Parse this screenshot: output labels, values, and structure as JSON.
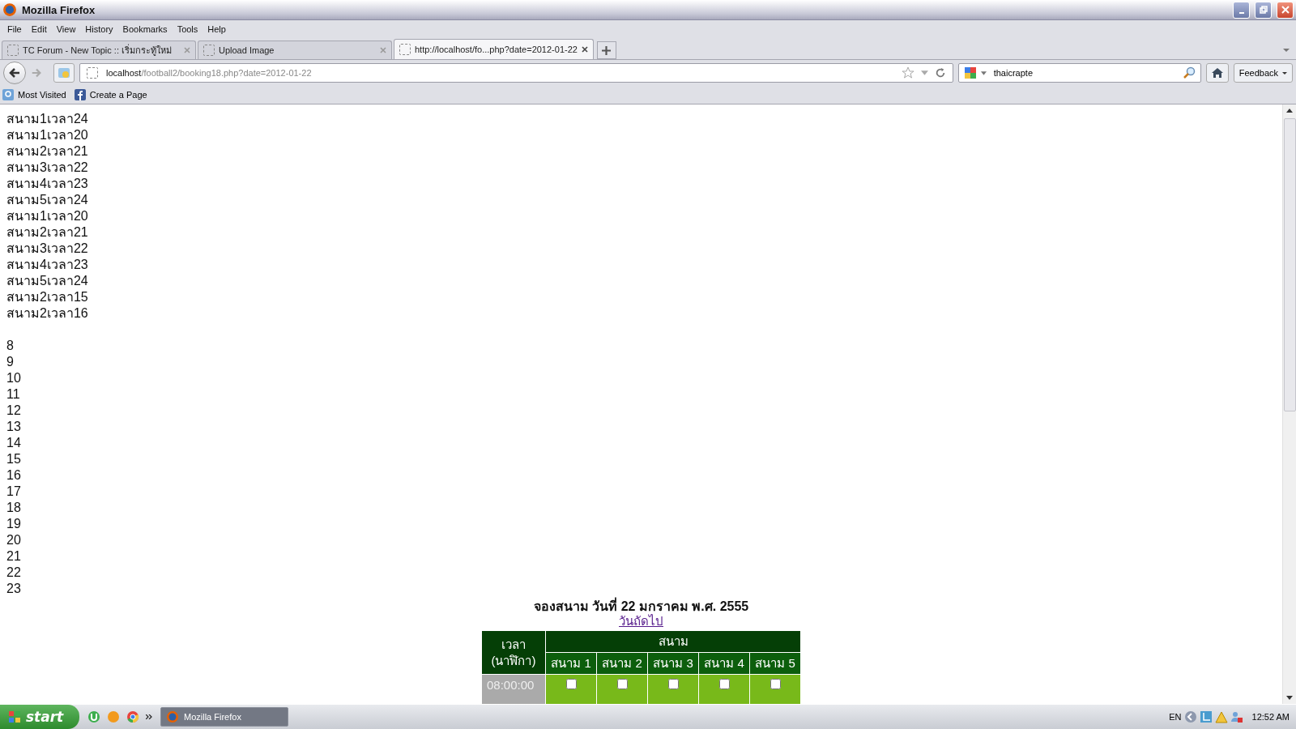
{
  "window": {
    "title": "Mozilla Firefox"
  },
  "menu": [
    "File",
    "Edit",
    "View",
    "History",
    "Bookmarks",
    "Tools",
    "Help"
  ],
  "tabs": [
    {
      "label": "TC Forum - New Topic :: เริ่มกระทู้ใหม่",
      "selected": false
    },
    {
      "label": "Upload Image",
      "selected": false
    },
    {
      "label": "http://localhost/fo...php?date=2012-01-22",
      "selected": true
    }
  ],
  "address": {
    "host": "localhost",
    "path": "/football2/booking18.php?date=2012-01-22"
  },
  "search": {
    "value": "thaicrapte"
  },
  "feedback": "Feedback",
  "bookmarks": [
    "Most Visited",
    "Create a Page"
  ],
  "log_lines": [
    "สนาม1เวลา24",
    "สนาม1เวลา20",
    "สนาม2เวลา21",
    "สนาม3เวลา22",
    "สนาม4เวลา23",
    "สนาม5เวลา24",
    "สนาม1เวลา20",
    "สนาม2เวลา21",
    "สนาม3เวลา22",
    "สนาม4เวลา23",
    "สนาม5เวลา24",
    "สนาม2เวลา15",
    "สนาม2เวลา16"
  ],
  "hours": [
    "8",
    "9",
    "10",
    "11",
    "12",
    "13",
    "14",
    "15",
    "16",
    "17",
    "18",
    "19",
    "20",
    "21",
    "22",
    "23"
  ],
  "booking": {
    "heading": "จองสนาม วันที่ 22 มกราคม พ.ศ. 2555",
    "next_link": "วันถัดไป",
    "time_header": "เวลา (นาฬิกา)",
    "fields_header": "สนาม",
    "fields": [
      "สนาม 1",
      "สนาม 2",
      "สนาม 3",
      "สนาม 4",
      "สนาม 5"
    ],
    "rows": [
      {
        "time": "08:00:00",
        "slots": [
          {
            "checked": false
          },
          {
            "checked": false
          },
          {
            "checked": false
          },
          {
            "checked": false
          },
          {
            "checked": false
          }
        ]
      }
    ]
  },
  "taskbar": {
    "start": "start",
    "window": "Mozilla Firefox",
    "lang": "EN",
    "clock": "12:52 AM"
  }
}
